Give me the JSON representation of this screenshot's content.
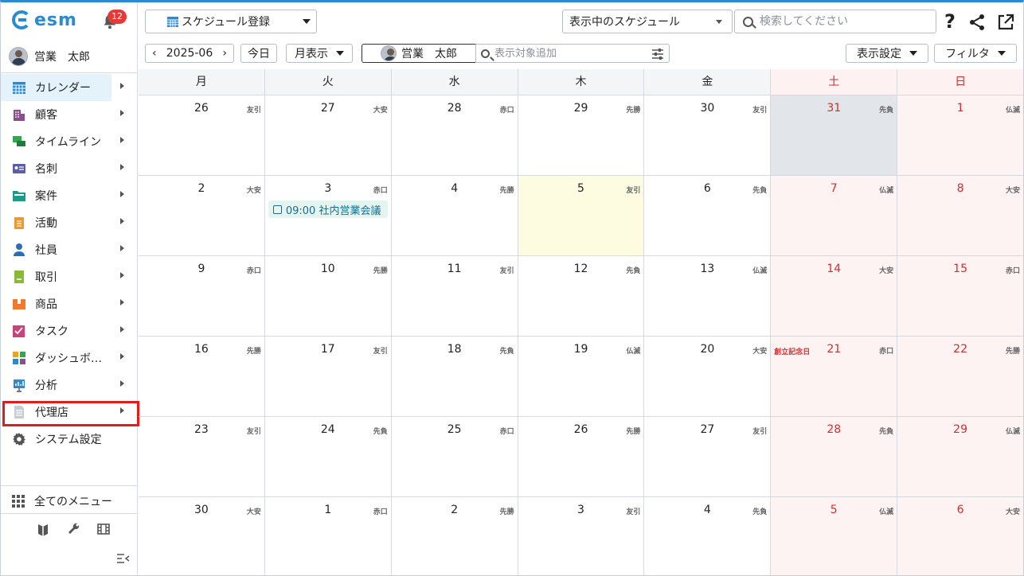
{
  "app": {
    "logo_text": "esm",
    "notification_count": "12"
  },
  "user": {
    "name": "営業　太郎"
  },
  "sidebar": {
    "items": [
      {
        "name": "calendar",
        "label": "カレンダー",
        "icon": "calendar-icon",
        "color": "#2a8bd0"
      },
      {
        "name": "customer",
        "label": "顧客",
        "icon": "building-icon",
        "color": "#8e4e8b"
      },
      {
        "name": "timeline",
        "label": "タイムライン",
        "icon": "chat-icon",
        "color": "#2fa84f"
      },
      {
        "name": "business-card",
        "label": "名刺",
        "icon": "card-icon",
        "color": "#5b5ea6"
      },
      {
        "name": "deal",
        "label": "案件",
        "icon": "folder-icon",
        "color": "#1e9a8a"
      },
      {
        "name": "activity",
        "label": "活動",
        "icon": "clipboard-icon",
        "color": "#f0962a"
      },
      {
        "name": "employee",
        "label": "社員",
        "icon": "person-icon",
        "color": "#2a6fb5"
      },
      {
        "name": "transaction",
        "label": "取引",
        "icon": "ledger-icon",
        "color": "#8bb83a"
      },
      {
        "name": "product",
        "label": "商品",
        "icon": "box-icon",
        "color": "#ef7a30"
      },
      {
        "name": "task",
        "label": "タスク",
        "icon": "checkbox-icon",
        "color": "#c9427a"
      },
      {
        "name": "dashboard",
        "label": "ダッシュボード",
        "icon": "dashboard-icon",
        "color": "#e4a52b"
      },
      {
        "name": "analysis",
        "label": "分析",
        "icon": "chart-icon",
        "color": "#2a8bd0"
      },
      {
        "name": "agency",
        "label": "代理店",
        "icon": "document-icon",
        "color": "#c7ccd3"
      },
      {
        "name": "system-settings",
        "label": "システム設定",
        "icon": "gear-icon",
        "color": "#555555"
      }
    ],
    "all_menu_label": "全てのメニュー"
  },
  "toolbar": {
    "register_label": "スケジュール登録",
    "display_select": "表示中のスケジュール",
    "search_placeholder": "検索してください",
    "month": "2025-06",
    "today_label": "今日",
    "view_label": "月表示",
    "target_user": "営業　太郎",
    "add_target_placeholder": "表示対象追加",
    "display_settings_label": "表示設定",
    "filter_label": "フィルタ"
  },
  "calendar": {
    "weekdays": [
      "月",
      "火",
      "水",
      "木",
      "金",
      "土",
      "日"
    ],
    "weeks": [
      [
        {
          "d": "26",
          "r": "友引"
        },
        {
          "d": "27",
          "r": "大安"
        },
        {
          "d": "28",
          "r": "赤口"
        },
        {
          "d": "29",
          "r": "先勝"
        },
        {
          "d": "30",
          "r": "友引"
        },
        {
          "d": "31",
          "r": "先負"
        },
        {
          "d": "1",
          "r": "仏滅"
        }
      ],
      [
        {
          "d": "2",
          "r": "大安"
        },
        {
          "d": "3",
          "r": "赤口",
          "event": "09:00 社内営業会議"
        },
        {
          "d": "4",
          "r": "先勝"
        },
        {
          "d": "5",
          "r": "友引"
        },
        {
          "d": "6",
          "r": "先負"
        },
        {
          "d": "7",
          "r": "仏滅"
        },
        {
          "d": "8",
          "r": "大安"
        }
      ],
      [
        {
          "d": "9",
          "r": "赤口"
        },
        {
          "d": "10",
          "r": "先勝"
        },
        {
          "d": "11",
          "r": "友引"
        },
        {
          "d": "12",
          "r": "先負"
        },
        {
          "d": "13",
          "r": "仏滅"
        },
        {
          "d": "14",
          "r": "大安"
        },
        {
          "d": "15",
          "r": "赤口"
        }
      ],
      [
        {
          "d": "16",
          "r": "先勝"
        },
        {
          "d": "17",
          "r": "友引"
        },
        {
          "d": "18",
          "r": "先負"
        },
        {
          "d": "19",
          "r": "仏滅"
        },
        {
          "d": "20",
          "r": "大安"
        },
        {
          "d": "21",
          "r": "赤口",
          "holiday": "創立記念日"
        },
        {
          "d": "22",
          "r": "先勝"
        }
      ],
      [
        {
          "d": "23",
          "r": "友引"
        },
        {
          "d": "24",
          "r": "先負"
        },
        {
          "d": "25",
          "r": "赤口"
        },
        {
          "d": "26",
          "r": "先勝"
        },
        {
          "d": "27",
          "r": "友引"
        },
        {
          "d": "28",
          "r": "先負"
        },
        {
          "d": "29",
          "r": "仏滅"
        }
      ],
      [
        {
          "d": "30",
          "r": "大安"
        },
        {
          "d": "1",
          "r": "赤口"
        },
        {
          "d": "2",
          "r": "先勝"
        },
        {
          "d": "3",
          "r": "友引"
        },
        {
          "d": "4",
          "r": "先負"
        },
        {
          "d": "5",
          "r": "仏滅"
        },
        {
          "d": "6",
          "r": "大安"
        }
      ]
    ]
  }
}
